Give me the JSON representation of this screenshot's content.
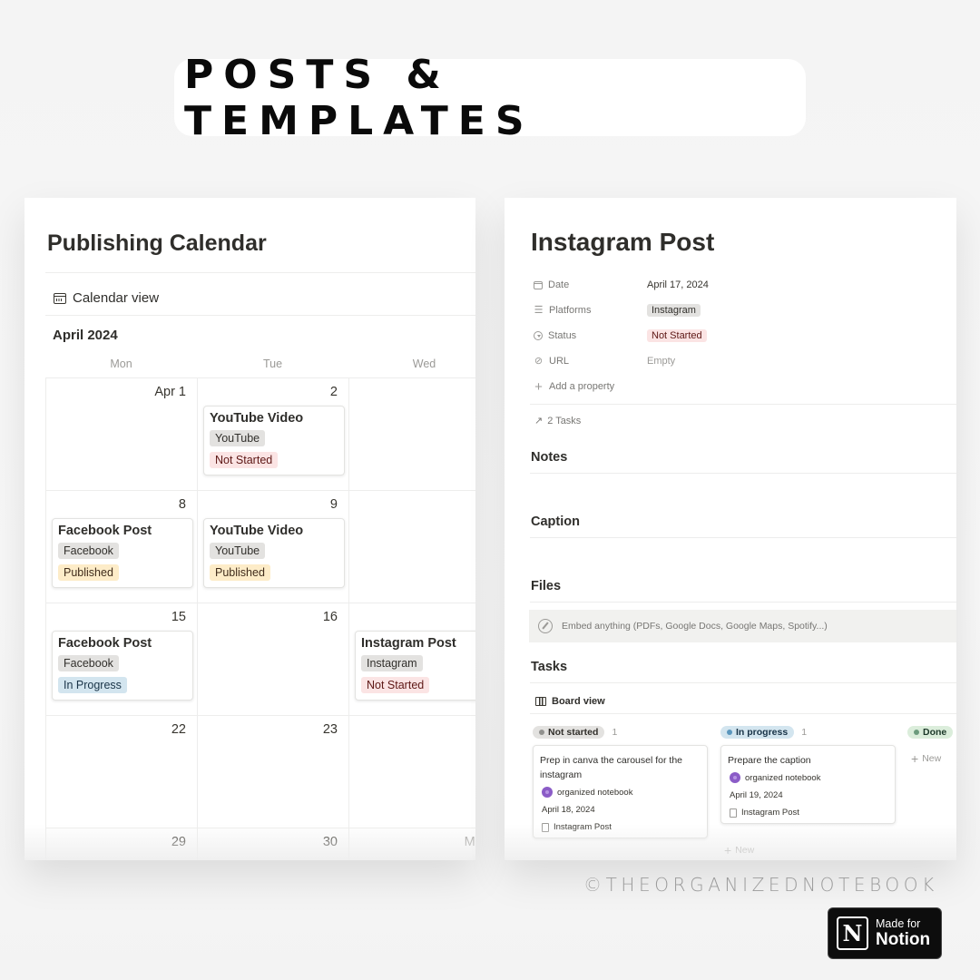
{
  "header": {
    "title": "POSTS & TEMPLATES"
  },
  "calendar": {
    "title": "Publishing Calendar",
    "view_label": "Calendar view",
    "view_icon": "calendar-icon",
    "month": "April 2024",
    "weekdays": [
      "Mon",
      "Tue",
      "Wed"
    ],
    "weeks": [
      {
        "days": [
          {
            "label": "Apr 1",
            "event": null
          },
          {
            "label": "2",
            "event": {
              "title": "YouTube Video",
              "platform": "YouTube",
              "status": "Not Started",
              "status_color": "red"
            }
          },
          {
            "label": "",
            "event": null
          }
        ]
      },
      {
        "days": [
          {
            "label": "8",
            "event": {
              "title": "Facebook Post",
              "platform": "Facebook",
              "status": "Published",
              "status_color": "yellow"
            }
          },
          {
            "label": "9",
            "event": {
              "title": "YouTube Video",
              "platform": "YouTube",
              "status": "Published",
              "status_color": "yellow"
            }
          },
          {
            "label": "",
            "event": null
          }
        ]
      },
      {
        "days": [
          {
            "label": "15",
            "event": {
              "title": "Facebook Post",
              "platform": "Facebook",
              "status": "In Progress",
              "status_color": "blue"
            }
          },
          {
            "label": "16",
            "event": null
          },
          {
            "label": "",
            "today": true,
            "event": {
              "title": "Instagram Post",
              "platform": "Instagram",
              "status": "Not Started",
              "status_color": "red"
            }
          }
        ]
      },
      {
        "days": [
          {
            "label": "22",
            "event": null
          },
          {
            "label": "23",
            "event": null
          },
          {
            "label": "",
            "event": null
          }
        ]
      },
      {
        "days": [
          {
            "label": "29",
            "event": null
          },
          {
            "label": "30",
            "event": null
          },
          {
            "label": "May",
            "muted": true,
            "event": null
          }
        ]
      }
    ]
  },
  "page": {
    "title": "Instagram Post",
    "properties": [
      {
        "icon": "calendar-icon",
        "name": "Date",
        "value": "April 17, 2024",
        "type": "text"
      },
      {
        "icon": "list-icon",
        "name": "Platforms",
        "value": "Instagram",
        "type": "tag-gray"
      },
      {
        "icon": "status-icon",
        "name": "Status",
        "value": "Not Started",
        "type": "tag-red"
      },
      {
        "icon": "link-icon",
        "name": "URL",
        "value": "Empty",
        "type": "empty"
      }
    ],
    "add_property": "Add a property",
    "tasks_link": "2 Tasks",
    "sections": {
      "notes": "Notes",
      "caption": "Caption",
      "files": "Files",
      "tasks": "Tasks"
    },
    "embed_placeholder": "Embed anything (PDFs, Google Docs, Google Maps, Spotify...)",
    "board": {
      "view_label": "Board view",
      "columns": [
        {
          "label": "Not started",
          "count": "1",
          "bg": "#e3e2e0",
          "dot": "#91918e",
          "color": "#32302c",
          "cards": [
            {
              "title": "Prep in canva the carousel for the instagram",
              "assignee": "organized notebook",
              "date": "April 18, 2024",
              "relation": "Instagram Post"
            }
          ]
        },
        {
          "label": "In progress",
          "count": "1",
          "bg": "#d3e5ef",
          "dot": "#5b97bd",
          "color": "#183347",
          "cards": [
            {
              "title": "Prepare the caption",
              "assignee": "organized notebook",
              "date": "April 19, 2024",
              "relation": "Instagram Post"
            }
          ]
        },
        {
          "label": "Done",
          "count": "",
          "bg": "#dbeddb",
          "dot": "#6c9b7d",
          "color": "#1c3829",
          "cards": []
        }
      ],
      "new_label": "New"
    }
  },
  "footer": {
    "copyright": "©THEORGANIZEDNOTEBOOK",
    "badge_small": "Made for",
    "badge_big": "Notion",
    "badge_logo": "N"
  }
}
